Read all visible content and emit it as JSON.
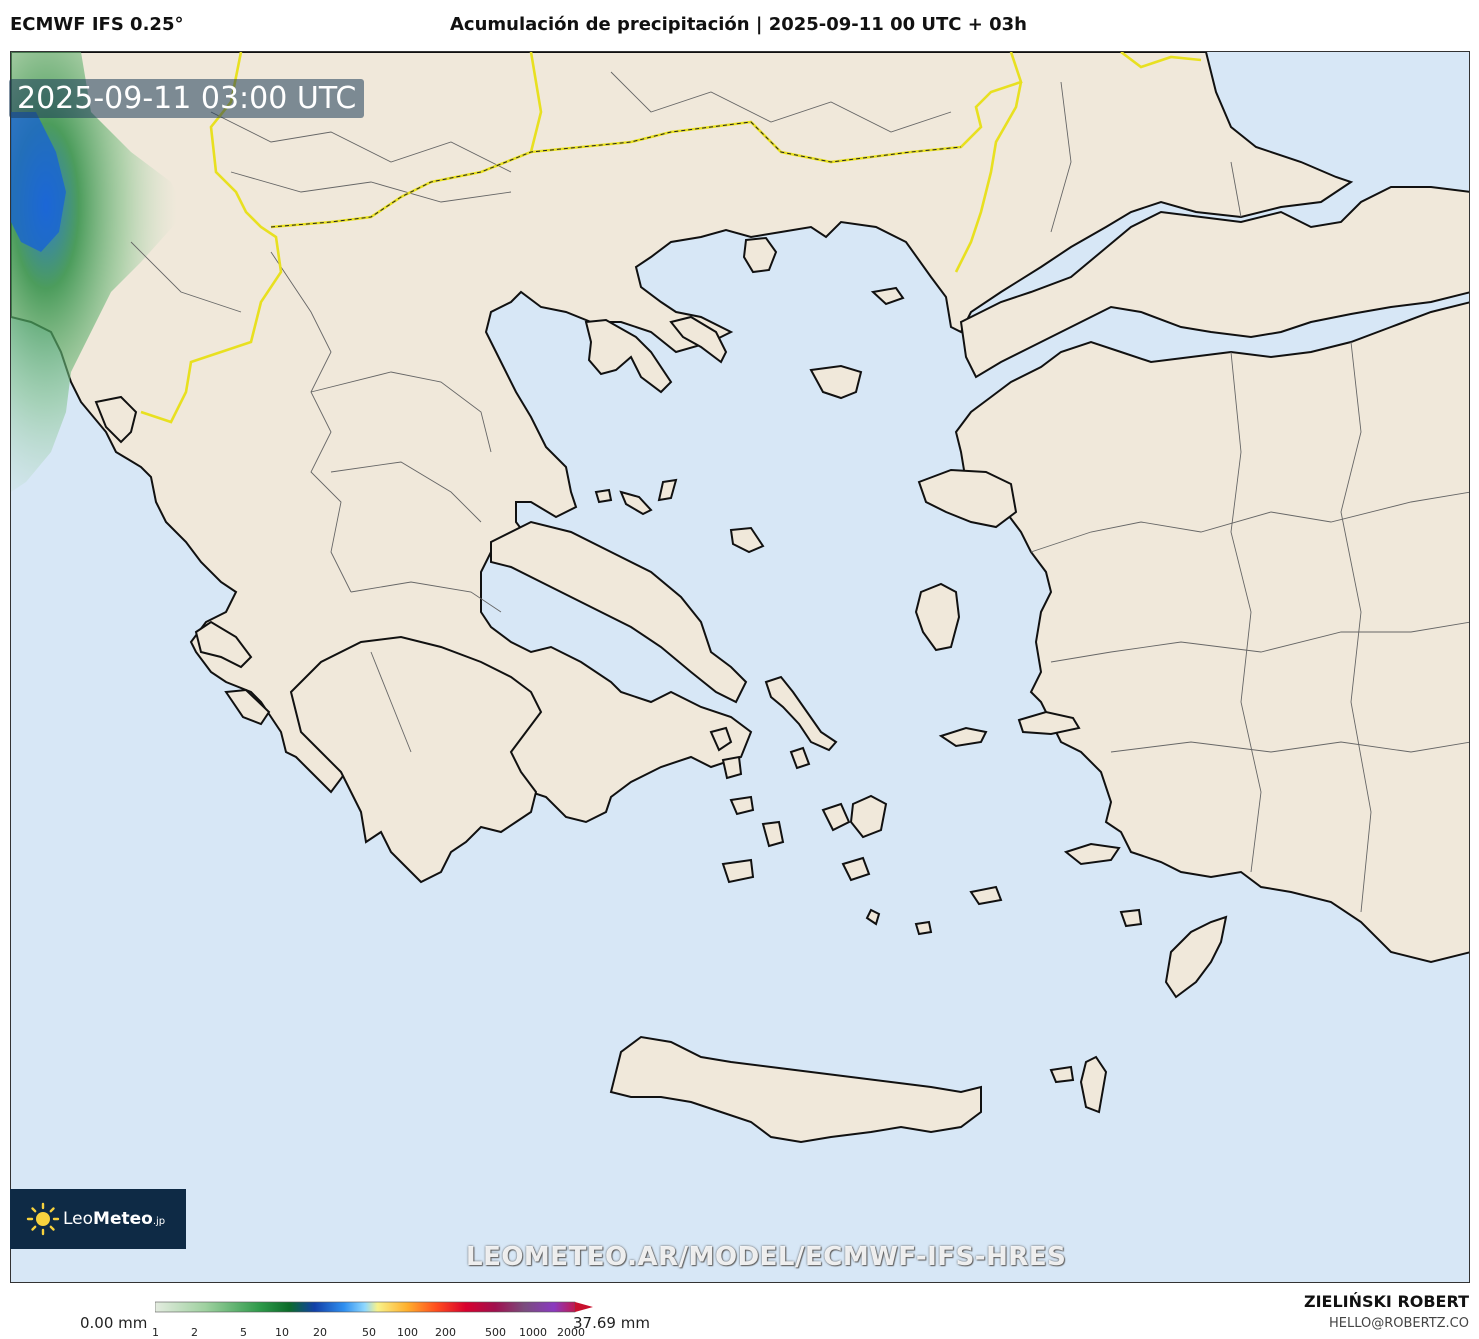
{
  "header": {
    "model": "ECMWF IFS 0.25°",
    "title": "Acumulación de precipitación | 2025-09-11 00 UTC + 03h"
  },
  "map": {
    "valid_time": "2025-09-11 03:00 UTC",
    "watermark": "LEOMETEO.AR/MODEL/ECMWF-IFS-HRES",
    "logo": {
      "prefix": "Leo",
      "bold": "Meteo",
      "suffix": ".jp"
    },
    "colors": {
      "sea": "#d7e7f6",
      "land": "#f0e8da",
      "coast": "#111111",
      "border": "#e8e020",
      "precip_green": "#3fa150",
      "precip_blue": "#1560d8"
    }
  },
  "legend": {
    "min_label": "0.00 mm",
    "max_label": "37.69 mm",
    "ticks": [
      "1",
      "2",
      "5",
      "10",
      "20",
      "50",
      "100",
      "200",
      "500",
      "1000",
      "2000"
    ]
  },
  "credit": {
    "author": "ZIELIŃSKI ROBERT",
    "email": "HELLO@ROBERTZ.CO"
  }
}
